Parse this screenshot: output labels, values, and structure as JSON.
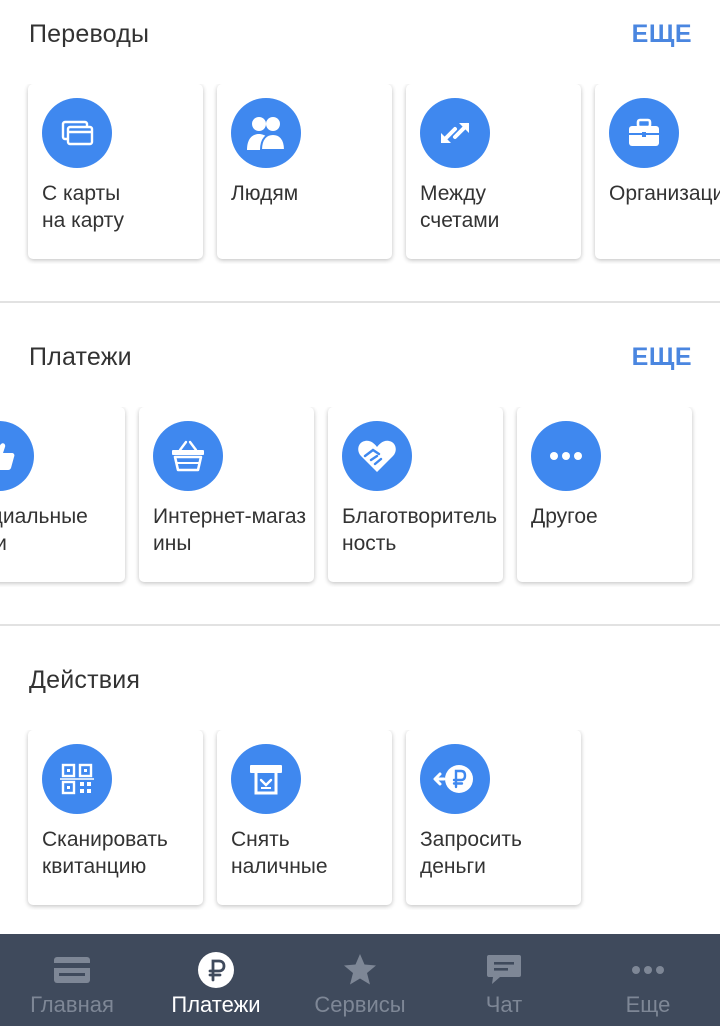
{
  "transfers": {
    "title": "Переводы",
    "more": "ЕЩЕ",
    "items": [
      {
        "icon": "cards-icon",
        "label": "С карты\nна карту"
      },
      {
        "icon": "people-icon",
        "label": "Людям"
      },
      {
        "icon": "exchange-arrows-icon",
        "label": "Между\nсчетами"
      },
      {
        "icon": "briefcase-icon",
        "label": "Организациям"
      }
    ]
  },
  "payments": {
    "title": "Платежи",
    "more": "ЕЩЕ",
    "items": [
      {
        "icon": "thumbs-up-icon",
        "label": "Социальные\nсети"
      },
      {
        "icon": "basket-icon",
        "label": "Интернет-магазины"
      },
      {
        "icon": "heart-hands-icon",
        "label": "Благотворительность"
      },
      {
        "icon": "more-dots-icon",
        "label": "Другое"
      }
    ]
  },
  "actions": {
    "title": "Действия",
    "items": [
      {
        "icon": "qr-code-icon",
        "label": "Сканировать\nквитанцию"
      },
      {
        "icon": "atm-icon",
        "label": "Снять\nналичные"
      },
      {
        "icon": "request-ruble-icon",
        "label": "Запросить\nденьги"
      }
    ]
  },
  "nav": {
    "items": [
      {
        "icon": "card-icon",
        "label": "Главная",
        "active": false
      },
      {
        "icon": "ruble-icon",
        "label": "Платежи",
        "active": true
      },
      {
        "icon": "star-icon",
        "label": "Сервисы",
        "active": false
      },
      {
        "icon": "chat-icon",
        "label": "Чат",
        "active": false
      },
      {
        "icon": "more-dots-icon",
        "label": "Еще",
        "active": false
      }
    ]
  },
  "colors": {
    "accent": "#4a86e0",
    "icon_bg": "#3f88ef",
    "nav_bg": "#3f4a5c",
    "nav_inactive": "#7e8796",
    "nav_active": "#ffffff"
  }
}
